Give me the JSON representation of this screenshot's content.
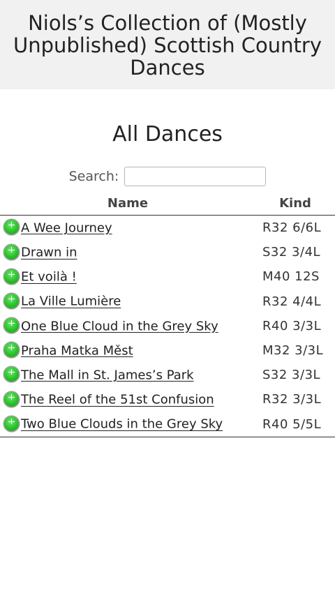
{
  "header": {
    "site_title": "Niols’s Collection of (Mostly Unpublished) Scottish Country Dances"
  },
  "main": {
    "page_title": "All Dances",
    "search": {
      "label": "Search:",
      "value": "",
      "placeholder": ""
    },
    "table": {
      "columns": [
        "Name",
        "Kind"
      ],
      "rows": [
        {
          "name": "A Wee Journey",
          "kind": "R32 6/6L"
        },
        {
          "name": "Drawn in",
          "kind": "S32 3/4L"
        },
        {
          "name": "Et voilà !",
          "kind": "M40 12S"
        },
        {
          "name": "La Ville Lumière",
          "kind": "R32 4/4L"
        },
        {
          "name": "One Blue Cloud in the Grey Sky",
          "kind": "R40 3/3L"
        },
        {
          "name": "Praha Matka Měst",
          "kind": "M32 3/3L"
        },
        {
          "name": "The Mall in St. James’s Park",
          "kind": "S32 3/3L"
        },
        {
          "name": "The Reel of the 51st Confusion",
          "kind": "R32 3/3L"
        },
        {
          "name": "Two Blue Clouds in the Grey Sky",
          "kind": "R40 5/5L"
        }
      ]
    }
  },
  "icons": {
    "add": "plus-circle-icon"
  },
  "colors": {
    "header_bg": "#f1f1f1",
    "add_icon": "#27c127"
  }
}
